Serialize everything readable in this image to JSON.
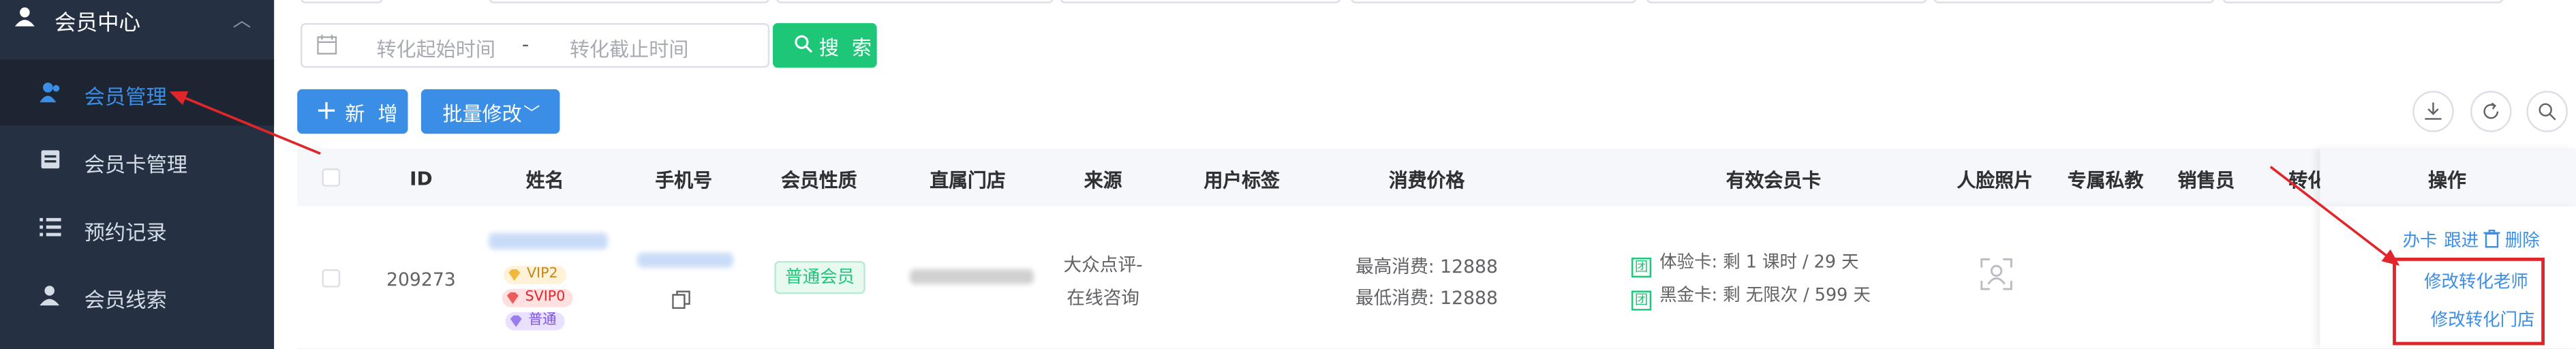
{
  "sidebar": {
    "group": {
      "label": "会员中心",
      "icon": "user-icon"
    },
    "items": [
      {
        "label": "会员管理",
        "icon": "users-icon",
        "active": true
      },
      {
        "label": "会员卡管理",
        "icon": "card-icon"
      },
      {
        "label": "预约记录",
        "icon": "list-icon"
      },
      {
        "label": "会员线索",
        "icon": "lead-icon"
      }
    ]
  },
  "search": {
    "start_placeholder": "转化起始时间",
    "separator": "-",
    "end_placeholder": "转化截止时间",
    "button_label": "搜 索"
  },
  "toolbar": {
    "add_label": "新 增",
    "batch_label": "批量修改"
  },
  "table": {
    "headers": [
      "ID",
      "姓名",
      "手机号",
      "会员性质",
      "直属门店",
      "来源",
      "用户标签",
      "消费价格",
      "有效会员卡",
      "人脸照片",
      "专属私教",
      "销售员",
      "转化老师",
      "操作"
    ],
    "rows": [
      {
        "id": "209273",
        "badges": [
          "VIP2",
          "SVIP0",
          "普通"
        ],
        "member_type": "普通会员",
        "source_line1": "大众点评-",
        "source_line2": "在线咨询",
        "price_max": "最高消费: 12888",
        "price_min": "最低消费: 12888",
        "cards": [
          {
            "icon": "团",
            "text": "体验卡: 剩 1 课时 / 29 天"
          },
          {
            "icon": "团",
            "text": "黑金卡: 剩 无限次 / 599 天"
          }
        ],
        "actions": {
          "card": "办卡",
          "follow": "跟进",
          "delete": "删除",
          "edit_teacher": "修改转化老师",
          "edit_store": "修改转化门店"
        }
      }
    ]
  },
  "colors": {
    "sidebar_bg": "#253142",
    "primary": "#3a8ee6",
    "success": "#1ec778",
    "annotation_red": "#e0262b"
  }
}
